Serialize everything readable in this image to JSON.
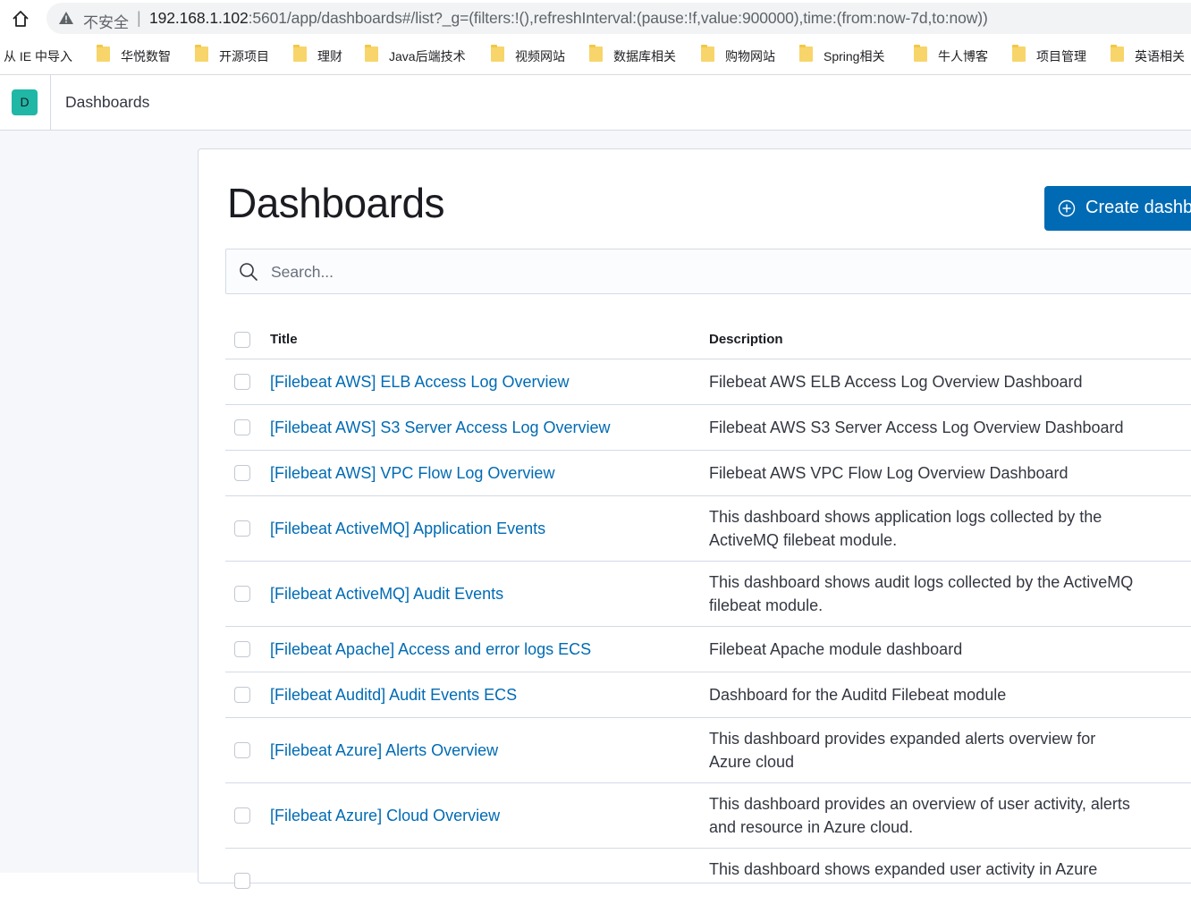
{
  "browser": {
    "security_label": "不安全",
    "separator": "|",
    "url_host": "192.168.1.102",
    "url_rest": ":5601/app/dashboards#/list?_g=(filters:!(),refreshInterval:(pause:!f,value:900000),time:(from:now-7d,to:now))",
    "bookmarks": [
      {
        "label": "从 IE 中导入",
        "folder": false
      },
      {
        "label": "华悦数智",
        "folder": true
      },
      {
        "label": "开源项目",
        "folder": true
      },
      {
        "label": "理财",
        "folder": true
      },
      {
        "label": "Java后端技术",
        "folder": true
      },
      {
        "label": "视频网站",
        "folder": true
      },
      {
        "label": "数据库相关",
        "folder": true
      },
      {
        "label": "购物网站",
        "folder": true
      },
      {
        "label": "Spring相关",
        "folder": true
      },
      {
        "label": "牛人博客",
        "folder": true
      },
      {
        "label": "项目管理",
        "folder": true
      },
      {
        "label": "英语相关",
        "folder": true
      }
    ]
  },
  "header": {
    "space_initial": "D",
    "space_color": "#20b7a6",
    "breadcrumb": "Dashboards"
  },
  "main": {
    "title": "Dashboards",
    "create_button": "Create dashb",
    "search_placeholder": "Search...",
    "accent_color": "#006bb4",
    "columns": {
      "title": "Title",
      "description": "Description"
    },
    "rows": [
      {
        "title": "[Filebeat AWS] ELB Access Log Overview",
        "description": "Filebeat AWS ELB Access Log Overview Dashboard"
      },
      {
        "title": "[Filebeat AWS] S3 Server Access Log Overview",
        "description": "Filebeat AWS S3 Server Access Log Overview Dashboard"
      },
      {
        "title": "[Filebeat AWS] VPC Flow Log Overview",
        "description": "Filebeat AWS VPC Flow Log Overview Dashboard"
      },
      {
        "title": "[Filebeat ActiveMQ] Application Events",
        "description": "This dashboard shows application logs collected by the ActiveMQ filebeat module."
      },
      {
        "title": "[Filebeat ActiveMQ] Audit Events",
        "description": "This dashboard shows audit logs collected by the ActiveMQ filebeat module."
      },
      {
        "title": "[Filebeat Apache] Access and error logs ECS",
        "description": "Filebeat Apache module dashboard"
      },
      {
        "title": "[Filebeat Auditd] Audit Events ECS",
        "description": "Dashboard for the Auditd Filebeat module"
      },
      {
        "title": "[Filebeat Azure] Alerts Overview",
        "description": "This dashboard provides expanded alerts overview for Azure cloud"
      },
      {
        "title": "[Filebeat Azure] Cloud Overview",
        "description": "This dashboard provides an overview of user activity, alerts and resource in Azure cloud."
      },
      {
        "title": "",
        "description": "This dashboard shows expanded user activity in Azure"
      }
    ]
  }
}
